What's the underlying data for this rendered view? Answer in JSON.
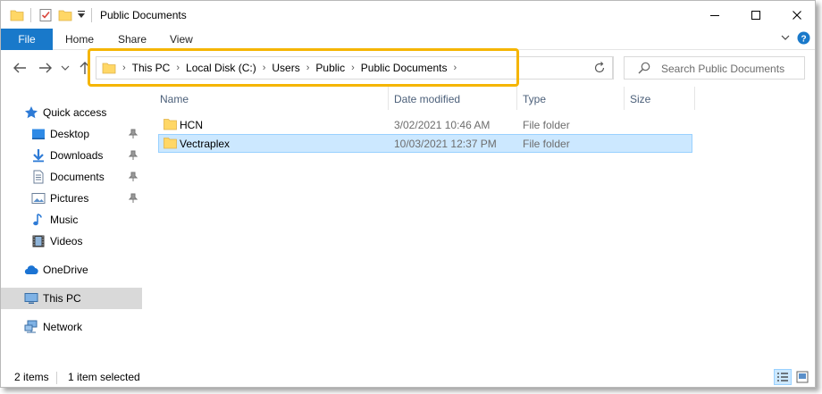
{
  "window": {
    "title": "Public Documents",
    "controls": {
      "minimize": "–",
      "maximize": "☐",
      "close": "✕"
    }
  },
  "ribbon": {
    "tabs": [
      "File",
      "Home",
      "Share",
      "View"
    ],
    "expand_icon": "chevron-down",
    "help_icon": "?"
  },
  "address": {
    "breadcrumbs": [
      "This PC",
      "Local Disk (C:)",
      "Users",
      "Public",
      "Public Documents"
    ],
    "search_placeholder": "Search Public Documents",
    "highlight_color": "#f5b500"
  },
  "sidebar": {
    "items": [
      {
        "label": "Quick access",
        "icon": "star-icon",
        "pinned": false
      },
      {
        "label": "Desktop",
        "icon": "desktop-icon",
        "pinned": true
      },
      {
        "label": "Downloads",
        "icon": "download-icon",
        "pinned": true
      },
      {
        "label": "Documents",
        "icon": "documents-icon",
        "pinned": true
      },
      {
        "label": "Pictures",
        "icon": "pictures-icon",
        "pinned": true
      },
      {
        "label": "Music",
        "icon": "music-icon",
        "pinned": false
      },
      {
        "label": "Videos",
        "icon": "videos-icon",
        "pinned": false
      },
      {
        "label": "OneDrive",
        "icon": "cloud-icon",
        "pinned": false
      },
      {
        "label": "This PC",
        "icon": "computer-icon",
        "pinned": false,
        "selected": true
      },
      {
        "label": "Network",
        "icon": "network-icon",
        "pinned": false
      }
    ]
  },
  "columns": {
    "name": "Name",
    "date": "Date modified",
    "type": "Type",
    "size": "Size"
  },
  "files": [
    {
      "name": "HCN",
      "date": "3/02/2021 10:46 AM",
      "type": "File folder",
      "selected": false
    },
    {
      "name": "Vectraplex",
      "date": "10/03/2021 12:37 PM",
      "type": "File folder",
      "selected": true
    }
  ],
  "status": {
    "count": "2 items",
    "selection": "1 item selected"
  },
  "colors": {
    "accent": "#1979ca",
    "selected_row": "#cce8ff",
    "folder": "#ffd766"
  }
}
